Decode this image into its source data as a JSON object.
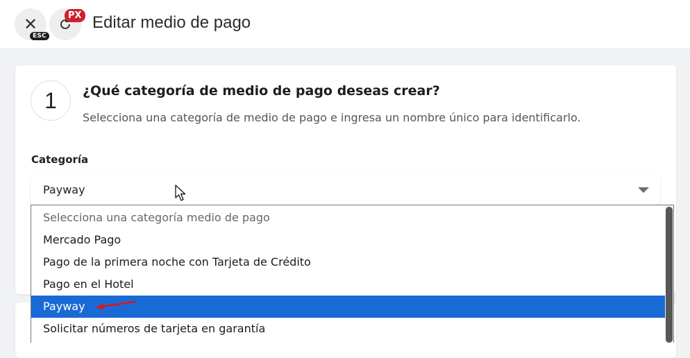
{
  "header": {
    "title": "Editar medio de pago",
    "close_icon": "close-icon",
    "close_badge": "ESC",
    "refresh_icon": "refresh-icon",
    "px_badge": "PX"
  },
  "step": {
    "number": "1",
    "title": "¿Qué categoría de medio de pago deseas crear?",
    "description": "Selecciona una categoría de medio de pago e ingresa un nombre único para identificarlo."
  },
  "category": {
    "label": "Categoría",
    "selected": "Payway",
    "options": [
      "Selecciona una categoría medio de pago",
      "Mercado Pago",
      "Pago de la primera noche con Tarjeta de Crédito",
      "Pago en el Hotel",
      "Payway",
      "Solicitar números de tarjeta en garantía"
    ],
    "highlighted_index": 4
  },
  "colors": {
    "selection": "#1a6ad6",
    "badge_red": "#d0202b",
    "annotation_arrow": "#e0121b"
  }
}
